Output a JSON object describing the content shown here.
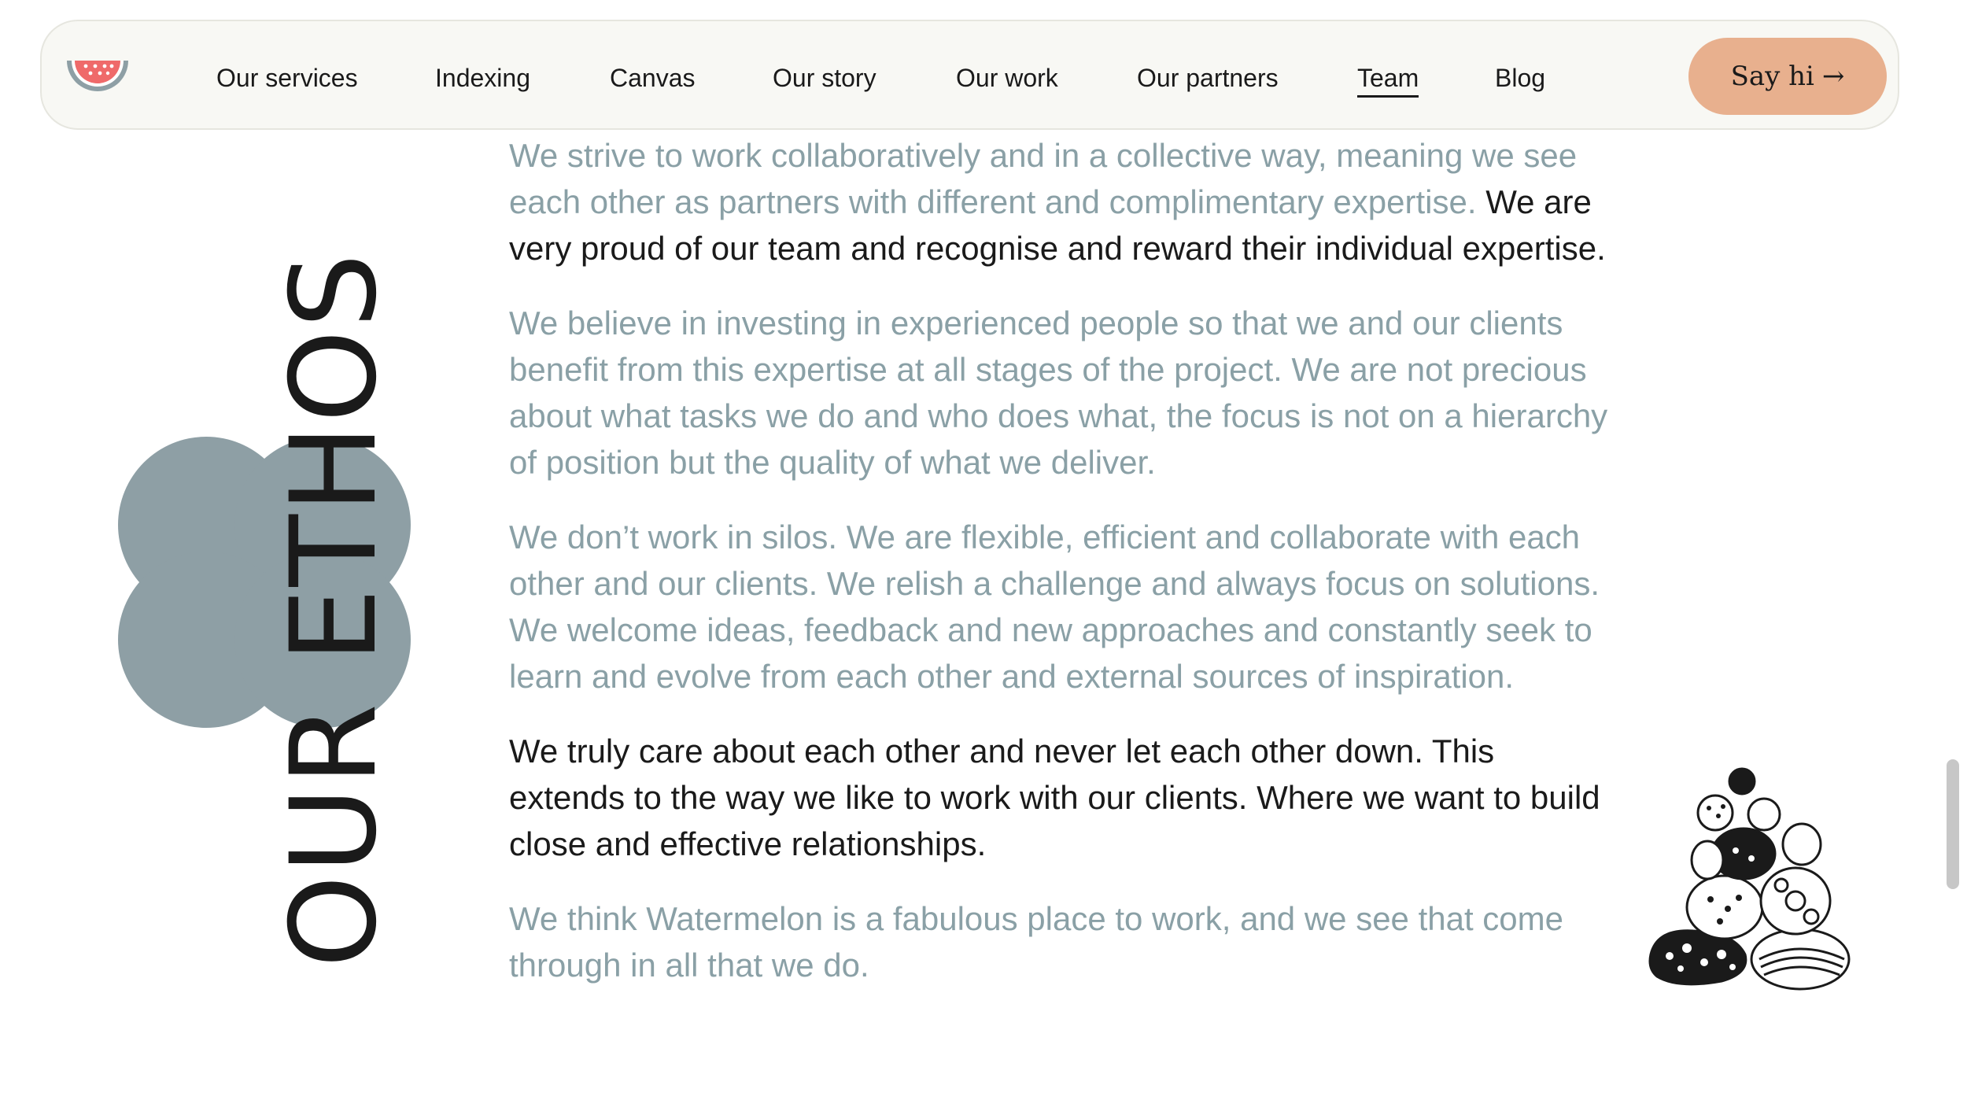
{
  "colors": {
    "accent_button": "#e8b08e",
    "blob": "#8e9fa5",
    "muted_text": "#8aa0a6",
    "dark_text": "#1a1a1a",
    "nav_background": "#f8f8f4",
    "logo_flesh": "#ef6a6a",
    "logo_rind": "#8e9fa5"
  },
  "nav": {
    "logo_icon": "watermelon-icon",
    "links": [
      {
        "label": "Our services"
      },
      {
        "label": "Indexing"
      },
      {
        "label": "Canvas"
      },
      {
        "label": "Our story"
      },
      {
        "label": "Our work"
      },
      {
        "label": "Our partners"
      },
      {
        "label": "Team",
        "active": true
      },
      {
        "label": "Blog"
      }
    ],
    "cta": {
      "label": "Say hi",
      "arrow": "→"
    }
  },
  "section": {
    "heading": "OUR ETHOS",
    "paragraphs": [
      {
        "muted": "We strive to work collaboratively and in a collective way, meaning we see each other as partners with different and complimentary expertise.",
        "dark": " We are very proud of our team and recognise and reward their individual expertise."
      },
      {
        "muted": "We believe in investing in experienced people so that we and our clients benefit from this expertise at all stages of the project. We are not precious about what tasks we do and who does what, the focus is not on a hierarchy of position but the quality of what we deliver."
      },
      {
        "muted": "We don’t work in silos. We are flexible, efficient and collaborate with each other and our clients. We relish a challenge and always focus on solutions. We welcome ideas, feedback and new approaches and constantly seek to learn and evolve from each other and external sources of inspiration."
      },
      {
        "dark": "We truly care about each other and never let each other down. This extends to the way we like to work with our clients. Where we want to build close and effective relationships."
      },
      {
        "muted": "We think Watermelon is a fabulous place to work, and we see that come through in all that we do."
      }
    ],
    "illustration_icon": "stacked-stones-icon",
    "decoration_icon": "quatrefoil-blob-icon"
  }
}
